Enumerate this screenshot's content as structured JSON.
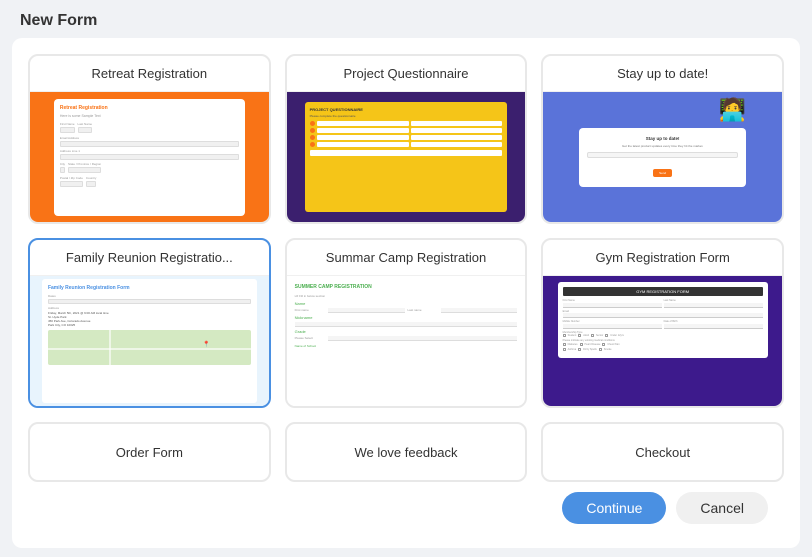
{
  "page": {
    "title": "New Form"
  },
  "cards": [
    {
      "id": "retreat-registration",
      "label": "Retreat Registration",
      "selected": false,
      "preview_type": "retreat"
    },
    {
      "id": "project-questionnaire",
      "label": "Project Questionnaire",
      "selected": false,
      "preview_type": "project"
    },
    {
      "id": "stay-up-to-date",
      "label": "Stay up to date!",
      "selected": false,
      "preview_type": "stayup"
    },
    {
      "id": "family-reunion",
      "label": "Family Reunion Registratio...",
      "selected": true,
      "preview_type": "family"
    },
    {
      "id": "summer-camp",
      "label": "Summar Camp Registration",
      "selected": false,
      "preview_type": "summer"
    },
    {
      "id": "gym-registration",
      "label": "Gym Registration Form",
      "selected": false,
      "preview_type": "gym"
    }
  ],
  "bottom_cards": [
    {
      "id": "order-form",
      "label": "Order Form"
    },
    {
      "id": "we-love-feedback",
      "label": "We love feedback"
    },
    {
      "id": "checkout",
      "label": "Checkout"
    }
  ],
  "buttons": {
    "continue": "Continue",
    "cancel": "Cancel"
  },
  "colors": {
    "selected_border": "#4a90e2",
    "continue_bg": "#4a90e2",
    "retreat_bg": "#f97316",
    "project_bg": "#3b1f6e",
    "stayup_bg": "#5a73d9",
    "summer_title": "#4caf50",
    "gym_bg": "#3d1a8c"
  }
}
